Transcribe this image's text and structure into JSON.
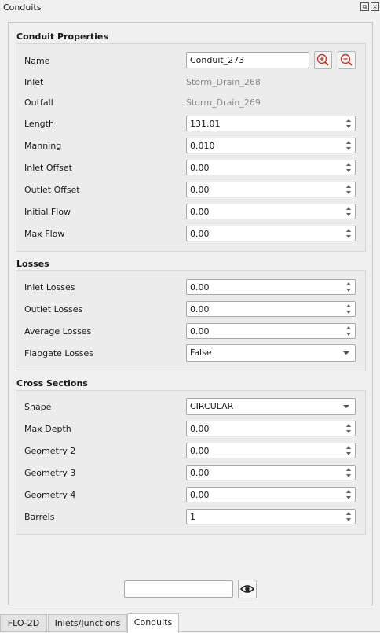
{
  "window": {
    "title": "Conduits"
  },
  "groups": {
    "properties": {
      "title": "Conduit Properties",
      "name_label": "Name",
      "name_value": "Conduit_273",
      "inlet_label": "Inlet",
      "inlet_value": "Storm_Drain_268",
      "outfall_label": "Outfall",
      "outfall_value": "Storm_Drain_269",
      "fields": [
        {
          "label": "Length",
          "value": "131.01"
        },
        {
          "label": "Manning",
          "value": "0.010"
        },
        {
          "label": "Inlet Offset",
          "value": "0.00"
        },
        {
          "label": "Outlet Offset",
          "value": "0.00"
        },
        {
          "label": "Initial Flow",
          "value": "0.00"
        },
        {
          "label": "Max Flow",
          "value": "0.00"
        }
      ]
    },
    "losses": {
      "title": "Losses",
      "fields": [
        {
          "label": "Inlet Losses",
          "value": "0.00"
        },
        {
          "label": "Outlet Losses",
          "value": "0.00"
        },
        {
          "label": "Average Losses",
          "value": "0.00"
        }
      ],
      "flapgate_label": "Flapgate Losses",
      "flapgate_value": "False"
    },
    "cross": {
      "title": "Cross Sections",
      "shape_label": "Shape",
      "shape_value": "CIRCULAR",
      "fields": [
        {
          "label": "Max Depth",
          "value": "0.00"
        },
        {
          "label": "Geometry 2",
          "value": "0.00"
        },
        {
          "label": "Geometry 3",
          "value": "0.00"
        },
        {
          "label": "Geometry 4",
          "value": "0.00"
        }
      ],
      "barrels_label": "Barrels",
      "barrels_value": "1"
    }
  },
  "bottom": {
    "search_value": ""
  },
  "tabs": [
    {
      "label": "FLO-2D"
    },
    {
      "label": "Inlets/Junctions"
    },
    {
      "label": "Conduits"
    }
  ],
  "colors": {
    "zoom_icon": "#c0392b",
    "eye_icon": "#222222"
  }
}
